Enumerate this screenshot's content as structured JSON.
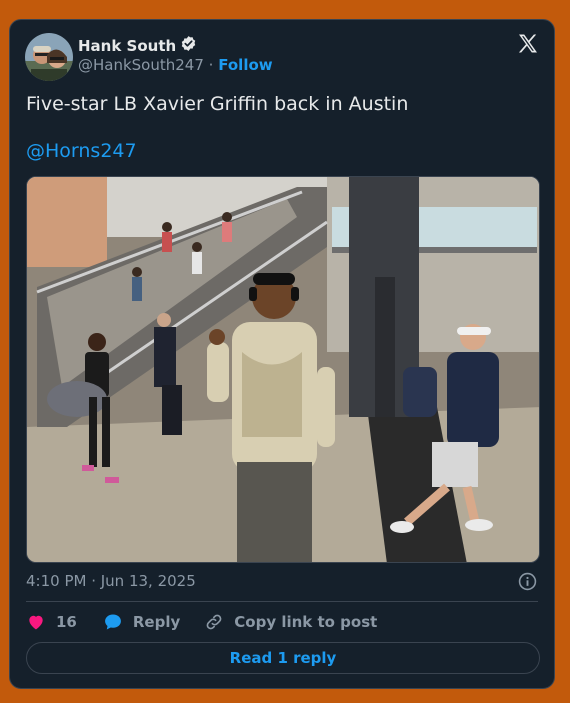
{
  "author": {
    "display_name": "Hank South",
    "handle": "@HankSouth247",
    "separator": "·",
    "follow_label": "Follow",
    "verified": true
  },
  "tweet": {
    "text": "Five-star LB Xavier Griffin back in Austin",
    "mention": "@Horns247",
    "timestamp": "4:10 PM · Jun 13, 2025"
  },
  "actions": {
    "like_count": "16",
    "reply_label": "Reply",
    "copy_link_label": "Copy link to post"
  },
  "read_reply_label": "Read 1 reply",
  "colors": {
    "page_background": "#c25a0c",
    "card_background": "#15202b",
    "accent": "#1d9bf0",
    "like": "#f91880"
  },
  "icons": [
    "verified-badge-icon",
    "x-logo-icon",
    "info-icon",
    "heart-icon",
    "reply-bubble-icon",
    "link-icon"
  ]
}
